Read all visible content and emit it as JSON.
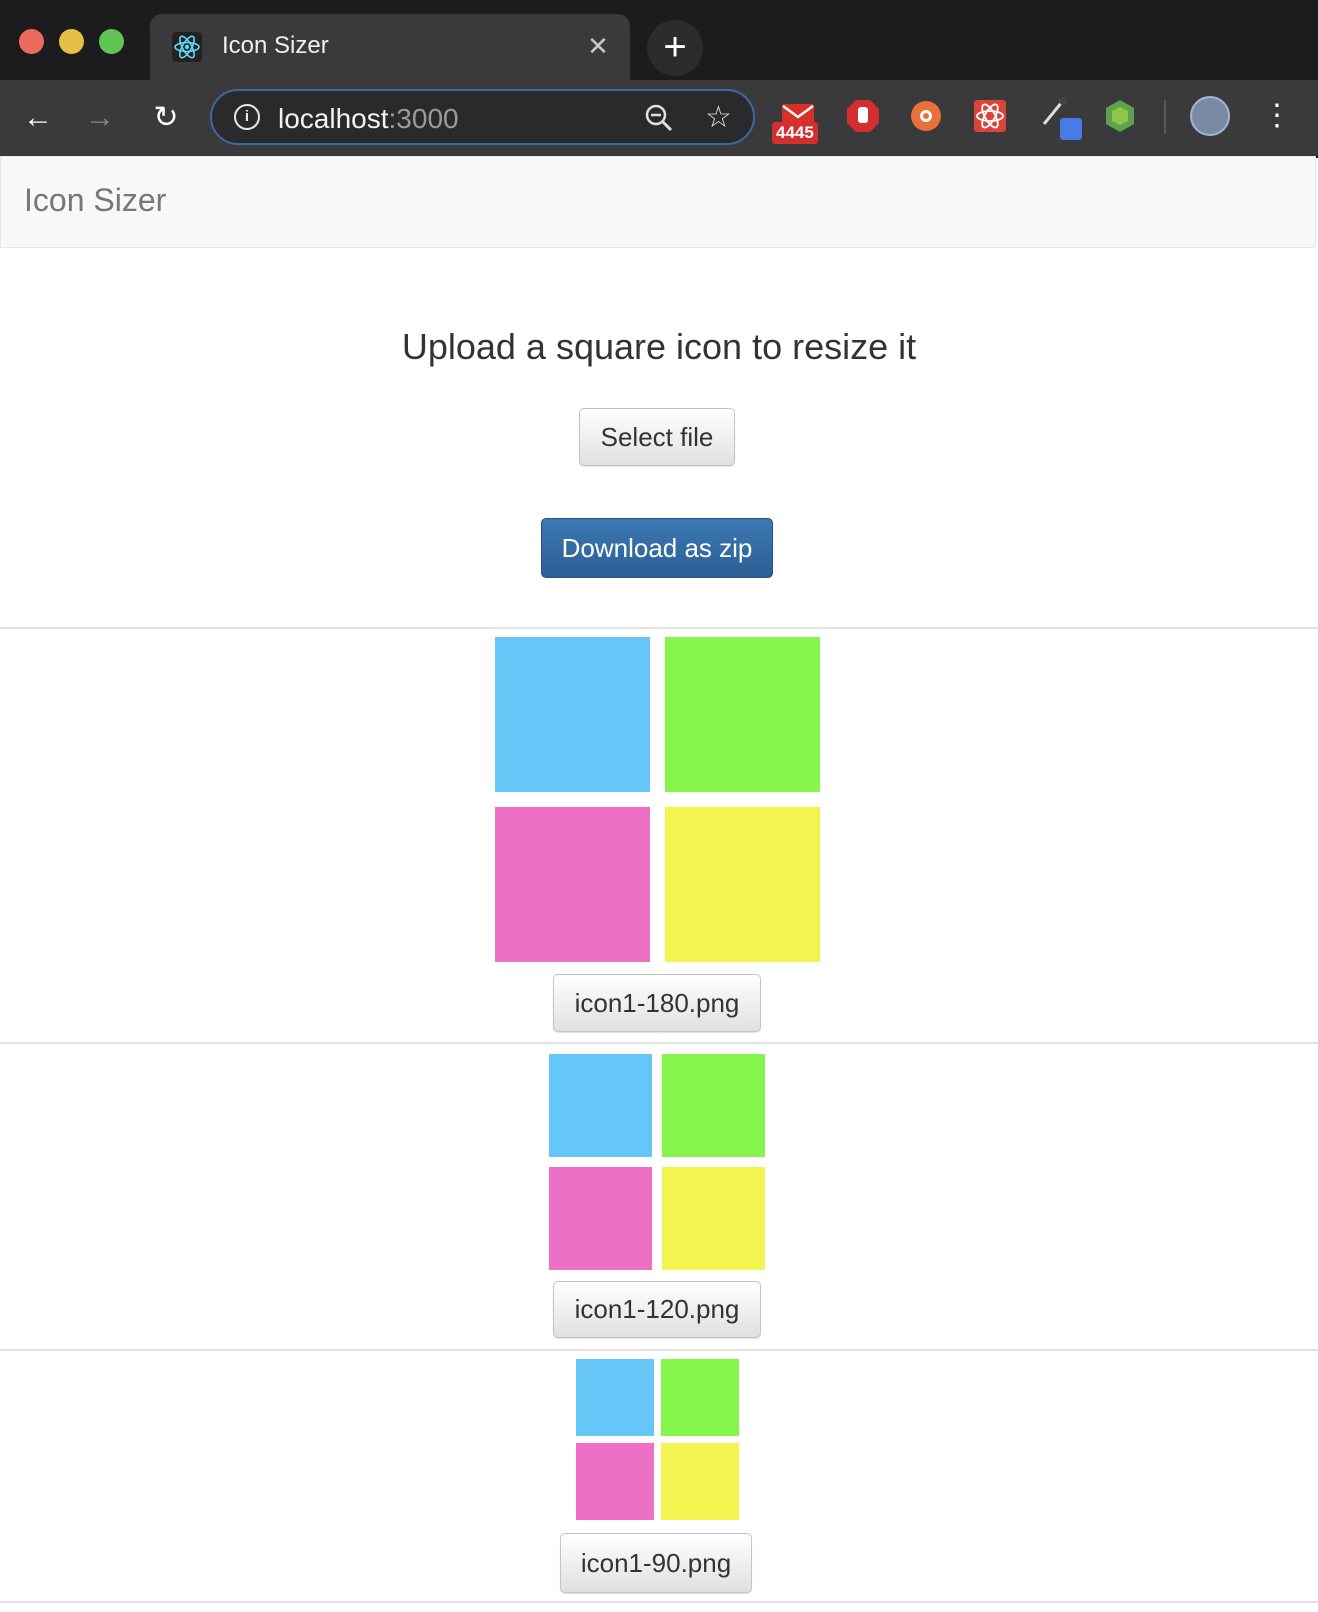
{
  "browser": {
    "tab_title": "Icon Sizer",
    "url_host": "localhost",
    "url_port": ":3000",
    "mail_badge": "4445"
  },
  "app": {
    "brand": "Icon Sizer",
    "heading": "Upload a square icon to resize it",
    "select_file_label": "Select file",
    "download_label": "Download as zip"
  },
  "icons": [
    {
      "filename": "icon1-180.png"
    },
    {
      "filename": "icon1-120.png"
    },
    {
      "filename": "icon1-90.png"
    }
  ],
  "colors": {
    "quadrant_top_left": "#66c6f7",
    "quadrant_top_right": "#86f54c",
    "quadrant_bottom_left": "#ed6fc6",
    "quadrant_bottom_right": "#f3f44f"
  }
}
